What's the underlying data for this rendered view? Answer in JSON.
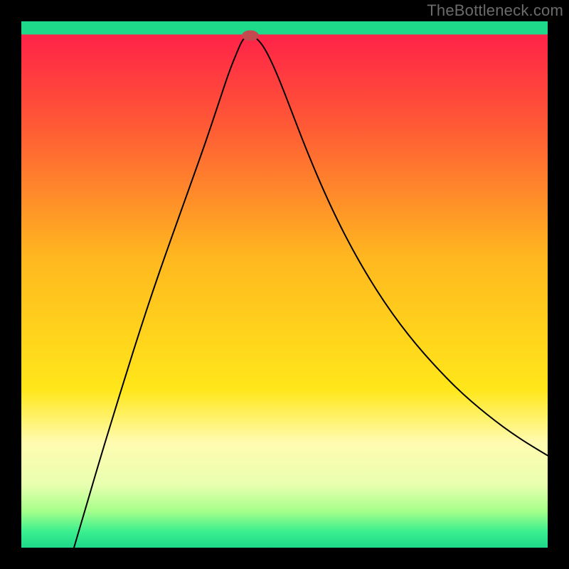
{
  "watermark": "TheBottleneck.com",
  "chart_data": {
    "type": "line",
    "title": "",
    "xlabel": "",
    "ylabel": "",
    "xlim": [
      0,
      100
    ],
    "ylim": [
      0,
      100
    ],
    "grid": false,
    "gradient_stops": [
      {
        "offset": 0.0,
        "color": "#ff1a4b"
      },
      {
        "offset": 0.2,
        "color": "#ff5a35"
      },
      {
        "offset": 0.45,
        "color": "#ffb81f"
      },
      {
        "offset": 0.7,
        "color": "#ffe71a"
      },
      {
        "offset": 0.8,
        "color": "#fffbb0"
      },
      {
        "offset": 0.88,
        "color": "#e9ffb0"
      },
      {
        "offset": 0.93,
        "color": "#a7ff8a"
      },
      {
        "offset": 0.97,
        "color": "#39ef8f"
      },
      {
        "offset": 1.0,
        "color": "#1fd98a"
      }
    ],
    "baseline_band": {
      "from_y": 97.5,
      "to_y": 100,
      "color": "#1fd98a"
    },
    "marker": {
      "x": 43.5,
      "y": 97.3,
      "color": "#c54a4f",
      "rx": 1.6,
      "ry": 1.0
    },
    "series": [
      {
        "name": "bottleneck-curve",
        "stroke": "#000000",
        "stroke_width": 2.0,
        "points": [
          {
            "x": 10.0,
            "y": 0.0
          },
          {
            "x": 12.5,
            "y": 8.5
          },
          {
            "x": 15.0,
            "y": 17.0
          },
          {
            "x": 17.5,
            "y": 25.2
          },
          {
            "x": 20.0,
            "y": 33.3
          },
          {
            "x": 22.5,
            "y": 41.2
          },
          {
            "x": 25.0,
            "y": 48.8
          },
          {
            "x": 27.5,
            "y": 56.0
          },
          {
            "x": 30.0,
            "y": 63.0
          },
          {
            "x": 32.5,
            "y": 70.0
          },
          {
            "x": 35.0,
            "y": 77.0
          },
          {
            "x": 37.5,
            "y": 84.5
          },
          {
            "x": 39.5,
            "y": 90.5
          },
          {
            "x": 41.0,
            "y": 94.2
          },
          {
            "x": 42.0,
            "y": 96.5
          },
          {
            "x": 43.0,
            "y": 97.3
          },
          {
            "x": 44.0,
            "y": 97.3
          },
          {
            "x": 45.5,
            "y": 96.0
          },
          {
            "x": 47.0,
            "y": 93.5
          },
          {
            "x": 49.0,
            "y": 89.0
          },
          {
            "x": 51.5,
            "y": 82.5
          },
          {
            "x": 54.0,
            "y": 76.0
          },
          {
            "x": 57.0,
            "y": 68.8
          },
          {
            "x": 60.0,
            "y": 62.3
          },
          {
            "x": 63.0,
            "y": 56.5
          },
          {
            "x": 66.0,
            "y": 51.3
          },
          {
            "x": 69.0,
            "y": 46.6
          },
          {
            "x": 72.0,
            "y": 42.4
          },
          {
            "x": 75.0,
            "y": 38.6
          },
          {
            "x": 78.0,
            "y": 35.2
          },
          {
            "x": 81.0,
            "y": 32.0
          },
          {
            "x": 84.0,
            "y": 29.1
          },
          {
            "x": 87.0,
            "y": 26.5
          },
          {
            "x": 90.0,
            "y": 24.1
          },
          {
            "x": 93.0,
            "y": 21.9
          },
          {
            "x": 96.0,
            "y": 19.9
          },
          {
            "x": 100.0,
            "y": 17.5
          }
        ]
      }
    ]
  }
}
